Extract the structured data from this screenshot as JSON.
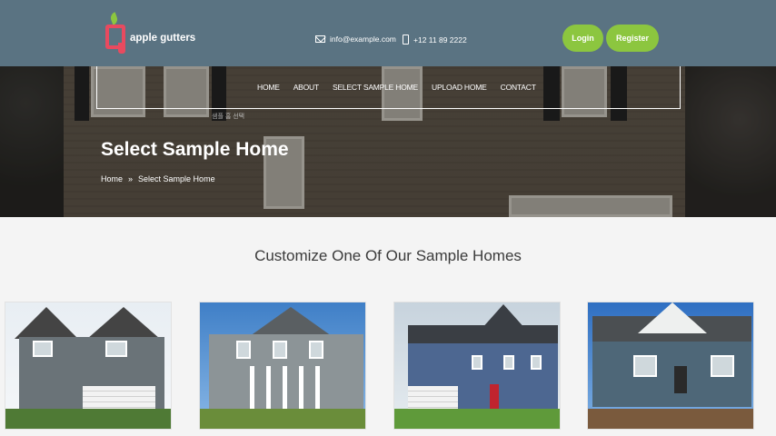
{
  "brand": {
    "name": "apple gutters"
  },
  "header": {
    "email": "info@example.com",
    "phone": "+12 11 89 2222",
    "login_label": "Login",
    "register_label": "Register"
  },
  "nav": {
    "items": [
      "HOME",
      "ABOUT",
      "SELECT SAMPLE HOME",
      "UPLOAD HOME",
      "CONTACT"
    ]
  },
  "hero": {
    "small_label": "샘플 홈 선택",
    "title": "Select Sample Home",
    "breadcrumb": [
      "Home",
      "Select Sample Home"
    ]
  },
  "section": {
    "title": "Customize One Of Our Sample Homes"
  },
  "colors": {
    "header_bg": "#5a7382",
    "accent_green": "#8cc63f",
    "logo_red": "#e84a5f"
  },
  "icons": [
    "mail-icon",
    "phone-icon",
    "chevron-right-icon"
  ]
}
